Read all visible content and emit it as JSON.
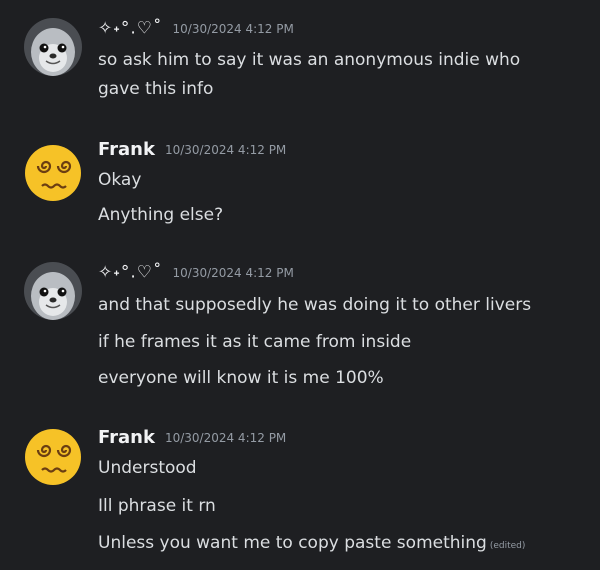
{
  "messages": [
    {
      "author": "✧˖°.♡˚",
      "timestamp": "10/30/2024 4:12 PM",
      "avatar": "seal-avatar",
      "lines": [
        "so ask him to say it was an anonymous indie who",
        "gave this info"
      ]
    },
    {
      "author": "Frank",
      "timestamp": "10/30/2024 4:12 PM",
      "avatar": "dizzy-face-emoji-avatar",
      "lines": [
        "Okay",
        "Anything else?"
      ]
    },
    {
      "author": "✧˖°.♡˚",
      "timestamp": "10/30/2024 4:12 PM",
      "avatar": "seal-avatar",
      "lines": [
        "and that supposedly he was doing it to other livers",
        "if he frames it as it came from inside",
        "everyone will know it is me 100%"
      ]
    },
    {
      "author": "Frank",
      "timestamp": "10/30/2024 4:12 PM",
      "avatar": "dizzy-face-emoji-avatar",
      "lines": [
        "Understood",
        "Ill phrase it rn",
        "Unless you want me to copy paste something"
      ],
      "edited_label": "(edited)"
    }
  ],
  "colors": {
    "background": "#1e1f22",
    "author": "#f2f3f5",
    "text": "#dbdee1",
    "timestamp": "#949ba4"
  }
}
